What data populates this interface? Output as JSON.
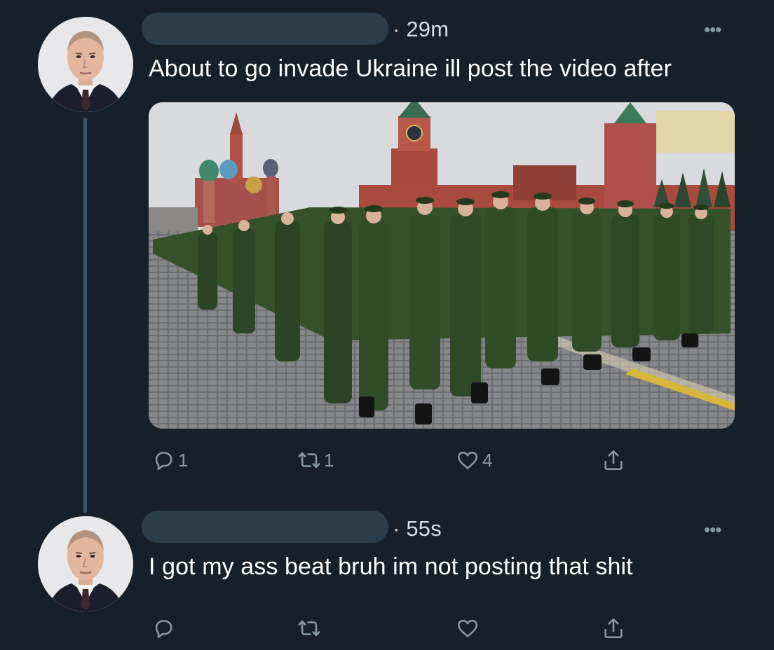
{
  "tweets": [
    {
      "time": "· 29m",
      "text": "About to go invade Ukraine ill post the video after",
      "more": "•••",
      "replies": "1",
      "retweets": "1",
      "likes": "4"
    },
    {
      "time": "· 55s",
      "text": "I got my ass beat bruh im not posting that shit",
      "more": "•••",
      "replies": "",
      "retweets": "",
      "likes": ""
    }
  ],
  "icons": [
    "reply-icon",
    "retweet-icon",
    "like-icon",
    "share-icon",
    "more-icon"
  ],
  "colors": {
    "background": "#15202b",
    "text": "#ffffff",
    "muted": "#8899a6",
    "thread_line": "#3d5466"
  }
}
